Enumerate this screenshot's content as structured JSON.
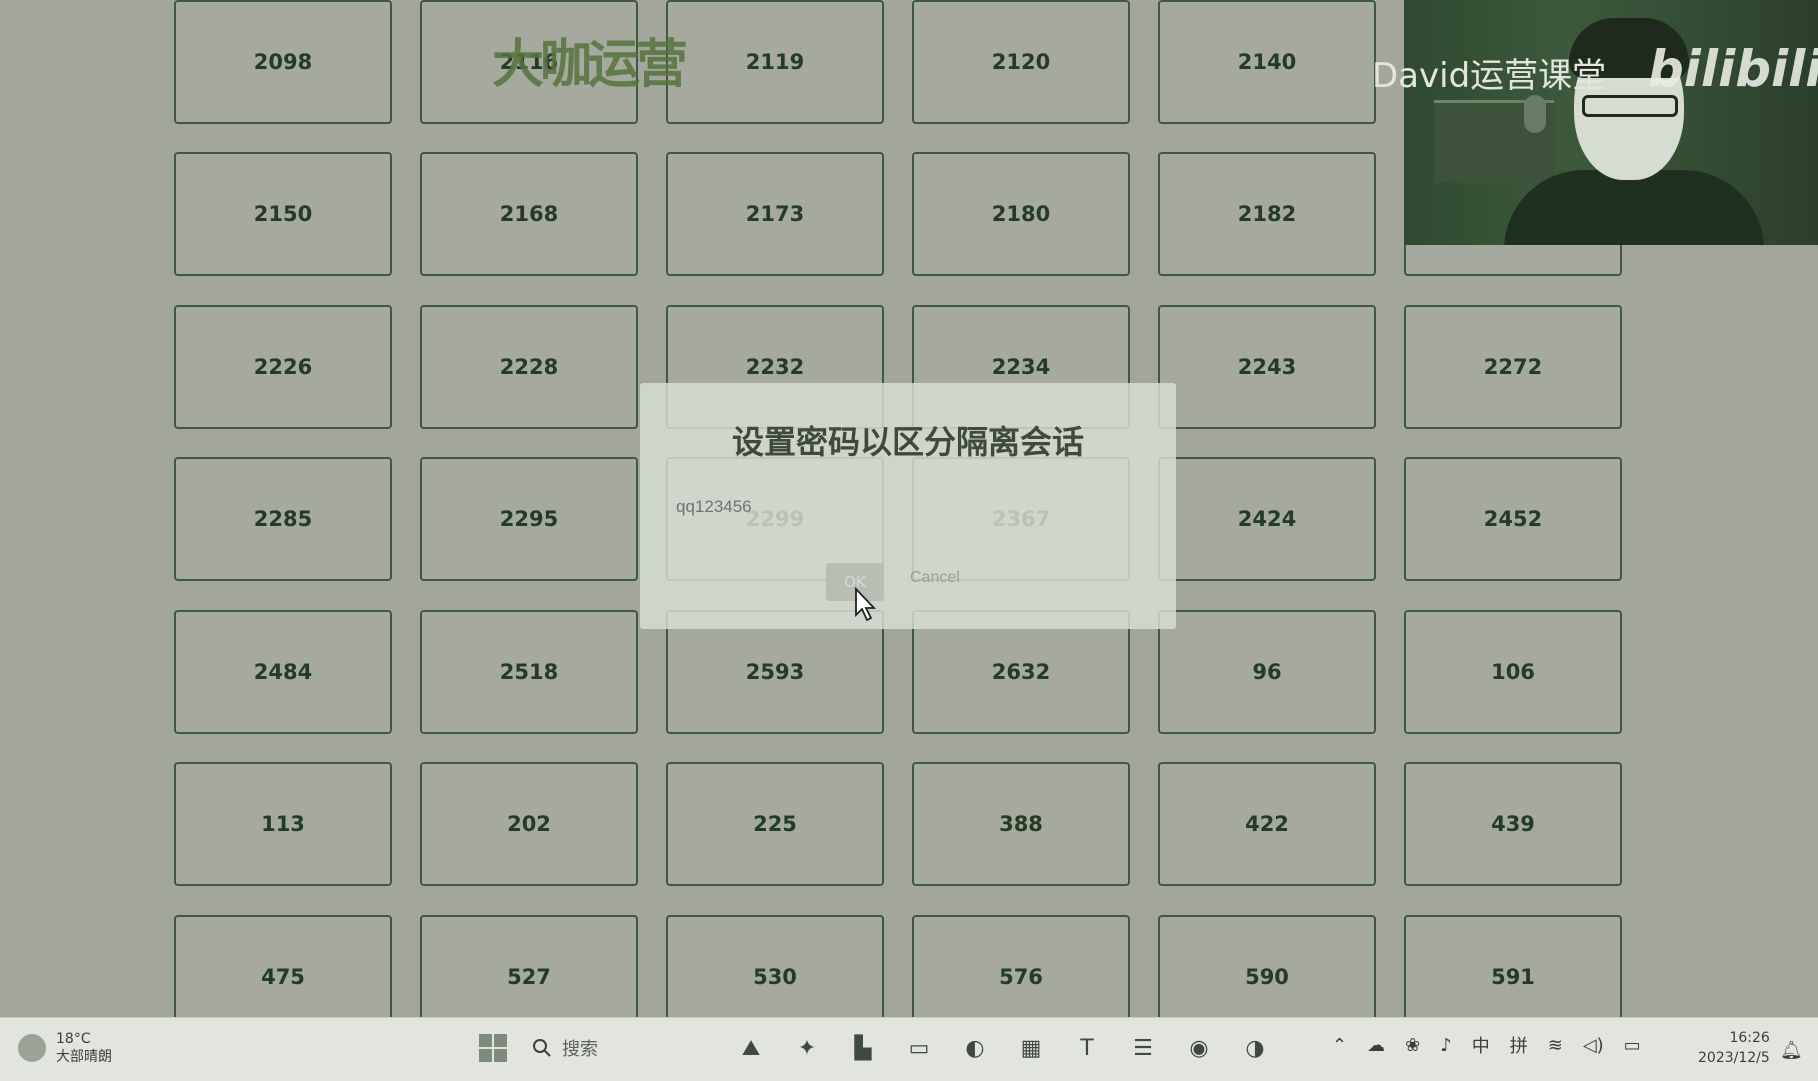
{
  "grid": {
    "rows": [
      [
        "2098",
        "2116",
        "2119",
        "2120",
        "2140",
        ""
      ],
      [
        "2150",
        "2168",
        "2173",
        "2180",
        "2182",
        ""
      ],
      [
        "2226",
        "2228",
        "2232",
        "2234",
        "2243",
        "2272"
      ],
      [
        "2285",
        "2295",
        "2299",
        "2367",
        "2424",
        "2452"
      ],
      [
        "2484",
        "2518",
        "2593",
        "2632",
        "96",
        "106"
      ],
      [
        "113",
        "202",
        "225",
        "388",
        "422",
        "439"
      ],
      [
        "475",
        "527",
        "530",
        "576",
        "590",
        "591"
      ]
    ]
  },
  "watermark": {
    "logo_text": "大咖运营"
  },
  "webcam": {
    "label": "David运营课堂",
    "brand": "bilibili"
  },
  "dialog": {
    "title": "设置密码以区分隔离会话",
    "input_value": "qq123456",
    "ok_label": "OK",
    "cancel_label": "Cancel"
  },
  "taskbar": {
    "weather_temp": "18°C",
    "weather_desc": "大部晴朗",
    "search_label": "搜索",
    "ime_lang": "中",
    "ime_mode": "拼",
    "time": "16:26",
    "date": "2023/12/5"
  },
  "colors": {
    "tile_border": "#3d5a3d",
    "tile_text": "#243c24",
    "background": "#a3a79b"
  }
}
